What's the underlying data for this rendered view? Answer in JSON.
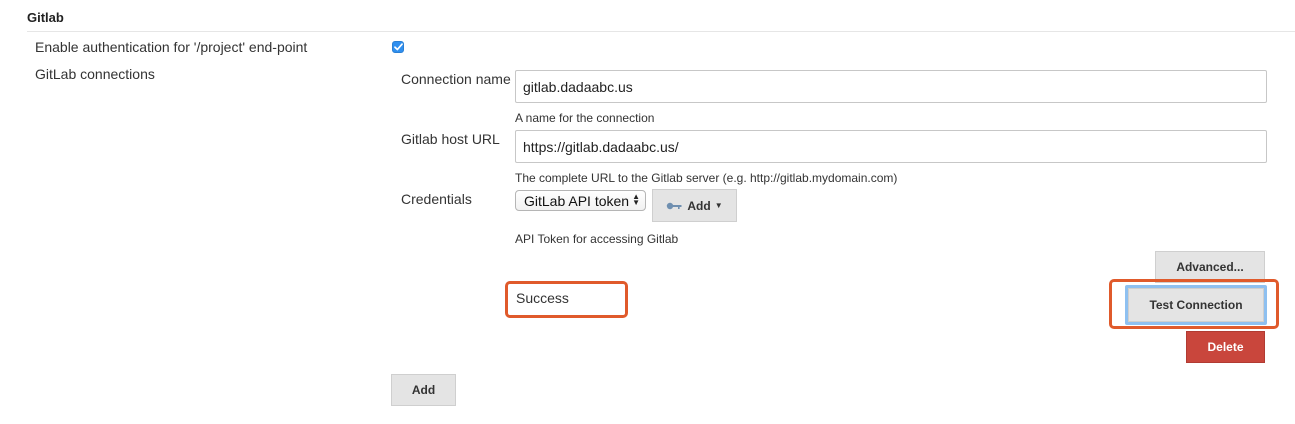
{
  "section": {
    "title": "Gitlab"
  },
  "auth": {
    "label": "Enable authentication for '/project' end-point",
    "checked": true
  },
  "connections": {
    "label": "GitLab connections",
    "connection_name": {
      "label": "Connection name",
      "value": "gitlab.dadaabc.us",
      "help": "A name for the connection"
    },
    "host_url": {
      "label": "Gitlab host URL",
      "value": "https://gitlab.dadaabc.us/",
      "help": "The complete URL to the Gitlab server (e.g. http://gitlab.mydomain.com)"
    },
    "credentials": {
      "label": "Credentials",
      "selected": "GitLab API token",
      "add_label": "Add",
      "help": "API Token for accessing Gitlab"
    },
    "advanced_label": "Advanced...",
    "status_text": "Success",
    "test_label": "Test Connection",
    "delete_label": "Delete",
    "highlight_color": "#e05a2b"
  },
  "add_connection_label": "Add",
  "colors": {
    "checkbox": "#2f8fef",
    "delete": "#c9463c",
    "button_grey": "#e4e4e4"
  }
}
